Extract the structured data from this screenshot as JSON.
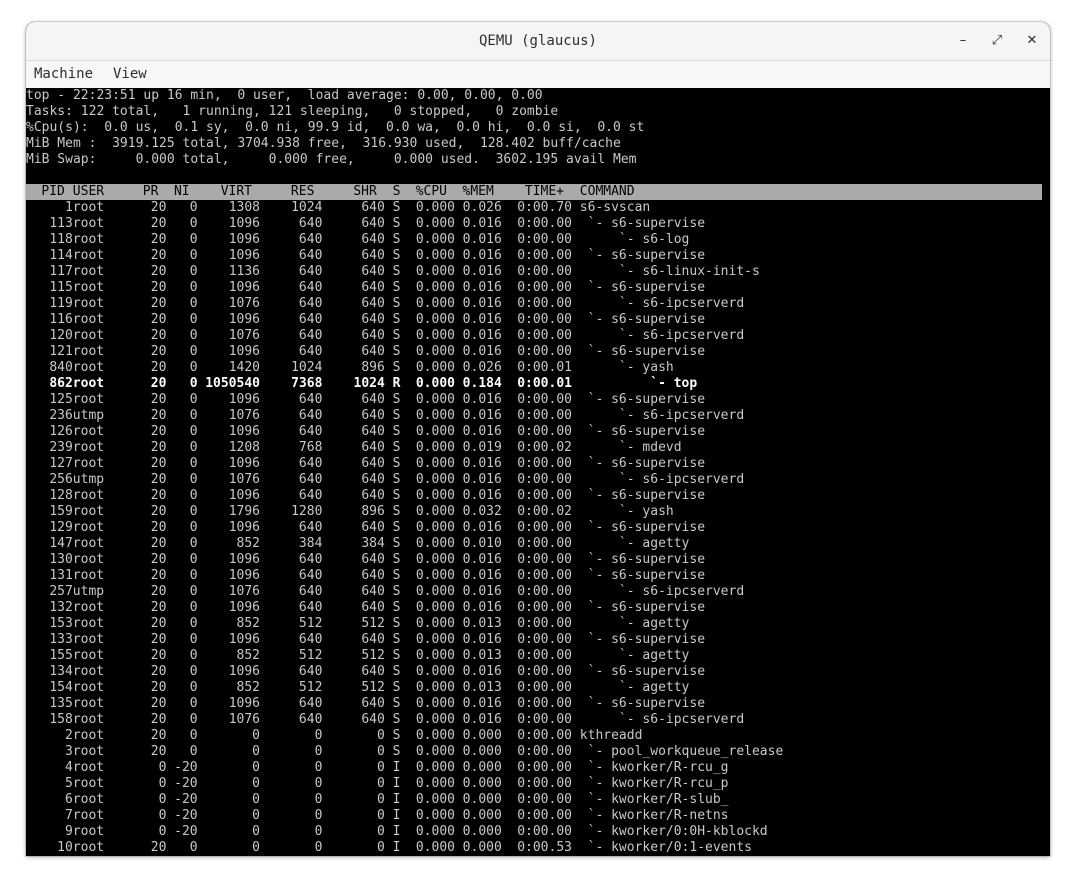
{
  "window": {
    "title": "QEMU (glaucus)",
    "buttons": {
      "minimize": "–",
      "maximize": "⤢",
      "close": "✕"
    }
  },
  "menubar": {
    "items": [
      "Machine",
      "View"
    ]
  },
  "summary": [
    "top - 22:23:51 up 16 min,  0 user,  load average: 0.00, 0.00, 0.00",
    "Tasks: 122 total,   1 running, 121 sleeping,   0 stopped,   0 zombie",
    "%Cpu(s):  0.0 us,  0.1 sy,  0.0 ni, 99.9 id,  0.0 wa,  0.0 hi,  0.0 si,  0.0 st",
    "MiB Mem :  3919.125 total, 3704.938 free,  316.930 used,  128.402 buff/cache",
    "MiB Swap:     0.000 total,     0.000 free,     0.000 used.  3602.195 avail Mem"
  ],
  "columns": [
    "PID",
    "USER",
    "PR",
    "NI",
    "VIRT",
    "RES",
    "SHR",
    "S",
    "%CPU",
    "%MEM",
    "TIME+",
    "COMMAND"
  ],
  "highlight_pid": "862",
  "processes": [
    [
      "1",
      "root",
      "20",
      "0",
      "1308",
      "1024",
      "640",
      "S",
      "0.000",
      "0.026",
      "0:00.70",
      "s6-svscan"
    ],
    [
      "113",
      "root",
      "20",
      "0",
      "1096",
      "640",
      "640",
      "S",
      "0.000",
      "0.016",
      "0:00.00",
      " `- s6-supervise"
    ],
    [
      "118",
      "root",
      "20",
      "0",
      "1096",
      "640",
      "640",
      "S",
      "0.000",
      "0.016",
      "0:00.00",
      "     `- s6-log"
    ],
    [
      "114",
      "root",
      "20",
      "0",
      "1096",
      "640",
      "640",
      "S",
      "0.000",
      "0.016",
      "0:00.00",
      " `- s6-supervise"
    ],
    [
      "117",
      "root",
      "20",
      "0",
      "1136",
      "640",
      "640",
      "S",
      "0.000",
      "0.016",
      "0:00.00",
      "     `- s6-linux-init-s"
    ],
    [
      "115",
      "root",
      "20",
      "0",
      "1096",
      "640",
      "640",
      "S",
      "0.000",
      "0.016",
      "0:00.00",
      " `- s6-supervise"
    ],
    [
      "119",
      "root",
      "20",
      "0",
      "1076",
      "640",
      "640",
      "S",
      "0.000",
      "0.016",
      "0:00.00",
      "     `- s6-ipcserverd"
    ],
    [
      "116",
      "root",
      "20",
      "0",
      "1096",
      "640",
      "640",
      "S",
      "0.000",
      "0.016",
      "0:00.00",
      " `- s6-supervise"
    ],
    [
      "120",
      "root",
      "20",
      "0",
      "1076",
      "640",
      "640",
      "S",
      "0.000",
      "0.016",
      "0:00.00",
      "     `- s6-ipcserverd"
    ],
    [
      "121",
      "root",
      "20",
      "0",
      "1096",
      "640",
      "640",
      "S",
      "0.000",
      "0.016",
      "0:00.00",
      " `- s6-supervise"
    ],
    [
      "840",
      "root",
      "20",
      "0",
      "1420",
      "1024",
      "896",
      "S",
      "0.000",
      "0.026",
      "0:00.01",
      "     `- yash"
    ],
    [
      "862",
      "root",
      "20",
      "0",
      "1050540",
      "7368",
      "1024",
      "R",
      "0.000",
      "0.184",
      "0:00.01",
      "         `- top"
    ],
    [
      "125",
      "root",
      "20",
      "0",
      "1096",
      "640",
      "640",
      "S",
      "0.000",
      "0.016",
      "0:00.00",
      " `- s6-supervise"
    ],
    [
      "236",
      "utmp",
      "20",
      "0",
      "1076",
      "640",
      "640",
      "S",
      "0.000",
      "0.016",
      "0:00.00",
      "     `- s6-ipcserverd"
    ],
    [
      "126",
      "root",
      "20",
      "0",
      "1096",
      "640",
      "640",
      "S",
      "0.000",
      "0.016",
      "0:00.00",
      " `- s6-supervise"
    ],
    [
      "239",
      "root",
      "20",
      "0",
      "1208",
      "768",
      "640",
      "S",
      "0.000",
      "0.019",
      "0:00.02",
      "     `- mdevd"
    ],
    [
      "127",
      "root",
      "20",
      "0",
      "1096",
      "640",
      "640",
      "S",
      "0.000",
      "0.016",
      "0:00.00",
      " `- s6-supervise"
    ],
    [
      "256",
      "utmp",
      "20",
      "0",
      "1076",
      "640",
      "640",
      "S",
      "0.000",
      "0.016",
      "0:00.00",
      "     `- s6-ipcserverd"
    ],
    [
      "128",
      "root",
      "20",
      "0",
      "1096",
      "640",
      "640",
      "S",
      "0.000",
      "0.016",
      "0:00.00",
      " `- s6-supervise"
    ],
    [
      "159",
      "root",
      "20",
      "0",
      "1796",
      "1280",
      "896",
      "S",
      "0.000",
      "0.032",
      "0:00.02",
      "     `- yash"
    ],
    [
      "129",
      "root",
      "20",
      "0",
      "1096",
      "640",
      "640",
      "S",
      "0.000",
      "0.016",
      "0:00.00",
      " `- s6-supervise"
    ],
    [
      "147",
      "root",
      "20",
      "0",
      "852",
      "384",
      "384",
      "S",
      "0.000",
      "0.010",
      "0:00.00",
      "     `- agetty"
    ],
    [
      "130",
      "root",
      "20",
      "0",
      "1096",
      "640",
      "640",
      "S",
      "0.000",
      "0.016",
      "0:00.00",
      " `- s6-supervise"
    ],
    [
      "131",
      "root",
      "20",
      "0",
      "1096",
      "640",
      "640",
      "S",
      "0.000",
      "0.016",
      "0:00.00",
      " `- s6-supervise"
    ],
    [
      "257",
      "utmp",
      "20",
      "0",
      "1076",
      "640",
      "640",
      "S",
      "0.000",
      "0.016",
      "0:00.00",
      "     `- s6-ipcserverd"
    ],
    [
      "132",
      "root",
      "20",
      "0",
      "1096",
      "640",
      "640",
      "S",
      "0.000",
      "0.016",
      "0:00.00",
      " `- s6-supervise"
    ],
    [
      "153",
      "root",
      "20",
      "0",
      "852",
      "512",
      "512",
      "S",
      "0.000",
      "0.013",
      "0:00.00",
      "     `- agetty"
    ],
    [
      "133",
      "root",
      "20",
      "0",
      "1096",
      "640",
      "640",
      "S",
      "0.000",
      "0.016",
      "0:00.00",
      " `- s6-supervise"
    ],
    [
      "155",
      "root",
      "20",
      "0",
      "852",
      "512",
      "512",
      "S",
      "0.000",
      "0.013",
      "0:00.00",
      "     `- agetty"
    ],
    [
      "134",
      "root",
      "20",
      "0",
      "1096",
      "640",
      "640",
      "S",
      "0.000",
      "0.016",
      "0:00.00",
      " `- s6-supervise"
    ],
    [
      "154",
      "root",
      "20",
      "0",
      "852",
      "512",
      "512",
      "S",
      "0.000",
      "0.013",
      "0:00.00",
      "     `- agetty"
    ],
    [
      "135",
      "root",
      "20",
      "0",
      "1096",
      "640",
      "640",
      "S",
      "0.000",
      "0.016",
      "0:00.00",
      " `- s6-supervise"
    ],
    [
      "158",
      "root",
      "20",
      "0",
      "1076",
      "640",
      "640",
      "S",
      "0.000",
      "0.016",
      "0:00.00",
      "     `- s6-ipcserverd"
    ],
    [
      "2",
      "root",
      "20",
      "0",
      "0",
      "0",
      "0",
      "S",
      "0.000",
      "0.000",
      "0:00.00",
      "kthreadd"
    ],
    [
      "3",
      "root",
      "20",
      "0",
      "0",
      "0",
      "0",
      "S",
      "0.000",
      "0.000",
      "0:00.00",
      " `- pool_workqueue_release"
    ],
    [
      "4",
      "root",
      "0",
      "-20",
      "0",
      "0",
      "0",
      "I",
      "0.000",
      "0.000",
      "0:00.00",
      " `- kworker/R-rcu_g"
    ],
    [
      "5",
      "root",
      "0",
      "-20",
      "0",
      "0",
      "0",
      "I",
      "0.000",
      "0.000",
      "0:00.00",
      " `- kworker/R-rcu_p"
    ],
    [
      "6",
      "root",
      "0",
      "-20",
      "0",
      "0",
      "0",
      "I",
      "0.000",
      "0.000",
      "0:00.00",
      " `- kworker/R-slub_"
    ],
    [
      "7",
      "root",
      "0",
      "-20",
      "0",
      "0",
      "0",
      "I",
      "0.000",
      "0.000",
      "0:00.00",
      " `- kworker/R-netns"
    ],
    [
      "9",
      "root",
      "0",
      "-20",
      "0",
      "0",
      "0",
      "I",
      "0.000",
      "0.000",
      "0:00.00",
      " `- kworker/0:0H-kblockd"
    ],
    [
      "10",
      "root",
      "20",
      "0",
      "0",
      "0",
      "0",
      "I",
      "0.000",
      "0.000",
      "0:00.53",
      " `- kworker/0:1-events"
    ]
  ]
}
